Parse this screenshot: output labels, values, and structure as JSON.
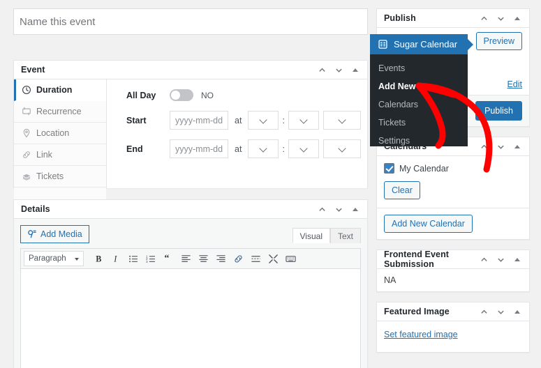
{
  "title_field": {
    "placeholder": "Name this event",
    "value": ""
  },
  "event_panel": {
    "title": "Event",
    "tabs": [
      {
        "label": "Duration",
        "icon": "clock-icon",
        "active": true
      },
      {
        "label": "Recurrence",
        "icon": "repeat-icon",
        "active": false
      },
      {
        "label": "Location",
        "icon": "map-pin-icon",
        "active": false
      },
      {
        "label": "Link",
        "icon": "link-icon",
        "active": false
      },
      {
        "label": "Tickets",
        "icon": "tickets-icon",
        "active": false
      }
    ],
    "all_day": {
      "label": "All Day",
      "state": "NO"
    },
    "start": {
      "label": "Start",
      "date_placeholder": "yyyy-mm-dd",
      "at": "at",
      "hour": "",
      "minute": "",
      "meridiem": "",
      "separator": ":"
    },
    "end": {
      "label": "End",
      "date_placeholder": "yyyy-mm-dd",
      "at": "at",
      "hour": "",
      "minute": "",
      "meridiem": "",
      "separator": ":"
    }
  },
  "details_panel": {
    "title": "Details",
    "add_media": "Add Media",
    "editor_tabs": [
      {
        "label": "Visual",
        "active": true
      },
      {
        "label": "Text",
        "active": false
      }
    ],
    "format_select": "Paragraph",
    "toolbar_buttons": [
      "bold-icon",
      "italic-icon",
      "bulleted-list-icon",
      "numbered-list-icon",
      "blockquote-icon",
      "align-left-icon",
      "align-center-icon",
      "align-right-icon",
      "link-icon",
      "read-more-icon",
      "fullscreen-icon",
      "toolbar-toggle-icon"
    ],
    "content": ""
  },
  "publish_panel": {
    "title": "Publish",
    "preview_button": "Preview",
    "edit_link": "Edit",
    "publish_button": "Publish"
  },
  "calendars_panel": {
    "title": "Calendars",
    "items": [
      {
        "label": "My Calendar",
        "checked": true
      }
    ],
    "clear_button": "Clear",
    "add_new_button": "Add New Calendar"
  },
  "frontend_panel": {
    "title": "Frontend Event Submission",
    "value": "NA"
  },
  "featured_image_panel": {
    "title": "Featured Image",
    "link": "Set featured image"
  },
  "plugin_menu": {
    "header": "Sugar Calendar",
    "header_icon": "sugar-calendar-icon",
    "items": [
      {
        "label": "Events",
        "current": false
      },
      {
        "label": "Add New",
        "current": true
      },
      {
        "label": "Calendars",
        "current": false
      },
      {
        "label": "Tickets",
        "current": false
      },
      {
        "label": "Settings",
        "current": false
      }
    ]
  },
  "panel_controls": {
    "up": "move-up",
    "down": "move-down",
    "toggle": "toggle-panel"
  },
  "annotation": {
    "type": "hand-drawn-arrow",
    "color": "#FF0000",
    "points_to": "Add New"
  },
  "colors": {
    "accent_blue": "#2271b1",
    "dark_menu": "#23282d",
    "page_background": "#f1f1f1",
    "annotation_red": "#FF0000"
  }
}
